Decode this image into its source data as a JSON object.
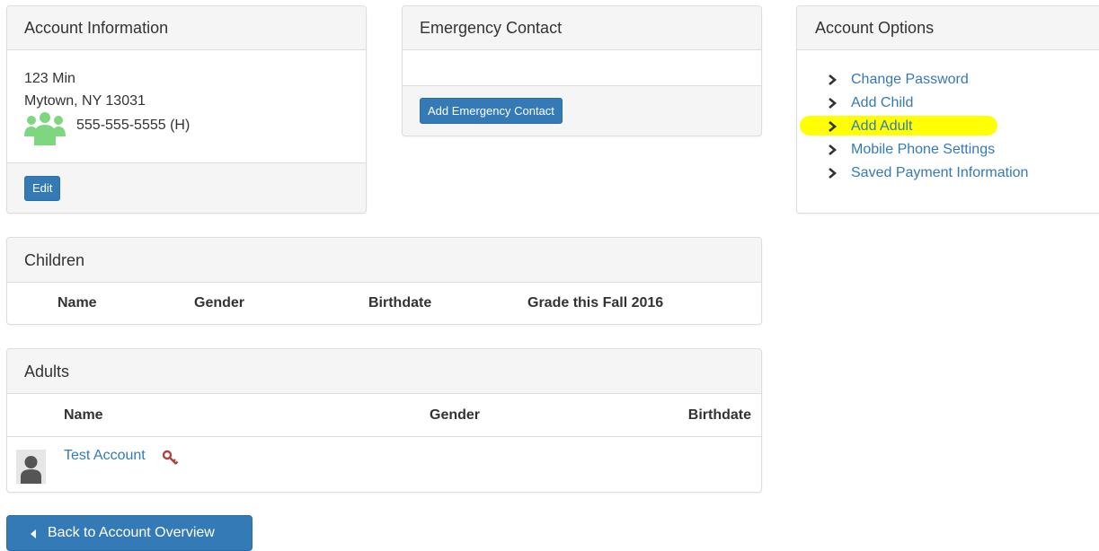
{
  "account_info": {
    "heading": "Account Information",
    "address_line1": "123 Min",
    "address_line2": "Mytown, NY 13031",
    "phone": "555-555-5555 (H)",
    "edit_label": "Edit",
    "family_icon": "family-icon"
  },
  "emergency_contact": {
    "heading": "Emergency Contact",
    "add_label": "Add Emergency Contact"
  },
  "account_options": {
    "heading": "Account Options",
    "chevron_icon": "chevron-right-icon",
    "items": [
      {
        "label": "Change Password"
      },
      {
        "label": "Add Child"
      },
      {
        "label": "Add Adult",
        "highlighted": true
      },
      {
        "label": "Mobile Phone Settings"
      },
      {
        "label": "Saved Payment Information"
      }
    ],
    "highlight_color": "#ffff00"
  },
  "children": {
    "heading": "Children",
    "columns": [
      "Name",
      "Gender",
      "Birthdate",
      "Grade this Fall 2016"
    ],
    "rows": []
  },
  "adults": {
    "heading": "Adults",
    "columns": [
      "Name",
      "Gender",
      "Birthdate"
    ],
    "rows": [
      {
        "name": "Test Account",
        "gender": "",
        "birthdate": "",
        "avatar_icon": "user-avatar-icon",
        "badge_icon": "key-icon"
      }
    ]
  },
  "back_button": {
    "label": "Back to Account Overview",
    "icon": "caret-left-icon"
  },
  "colors": {
    "primary": "#337ab7",
    "link": "#337ab7",
    "panel_heading_bg": "#f5f5f5",
    "border": "#dddddd",
    "family_icon": "#7ed67e",
    "key_icon": "#a94442"
  }
}
